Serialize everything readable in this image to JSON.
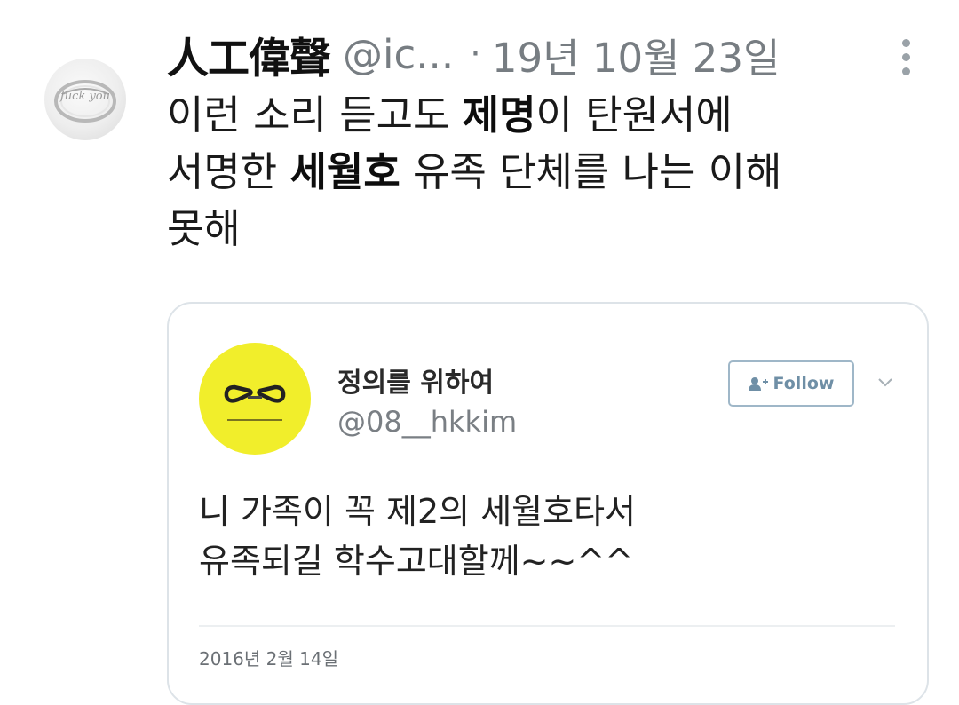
{
  "tweet": {
    "display_name": "人工偉聲",
    "handle": "@ic...",
    "separator": "·",
    "date": "19년 10월 23일",
    "avatar_icon": "ring-icon",
    "avatar_text": "fuck you",
    "text": {
      "line1_part1": "이런 소리 듣고도 ",
      "line1_bold": "제명",
      "line1_part2": "이 탄원서에",
      "line2_part1": "서명한 ",
      "line2_bold": "세월호",
      "line2_part2": " 유족 단체를 나는 이해",
      "line3": "못해"
    }
  },
  "embedded": {
    "name": "정의를 위하여",
    "handle": "@08__hkkim",
    "follow_label": "Follow",
    "follow_icon": "add-user-icon",
    "menu_icon": "chevron-down-icon",
    "avatar_icon": "ribbon-icon",
    "avatar_color": "#f1ee2b",
    "text_line1": "니 가족이 꼭 제2의 세월호타서",
    "text_line2": "유족되길 학수고대할께~~^^",
    "date": "2016년 2월 14일"
  },
  "colors": {
    "muted": "#777d82",
    "border": "#dde3e8",
    "follow": "#6f8fa6"
  }
}
